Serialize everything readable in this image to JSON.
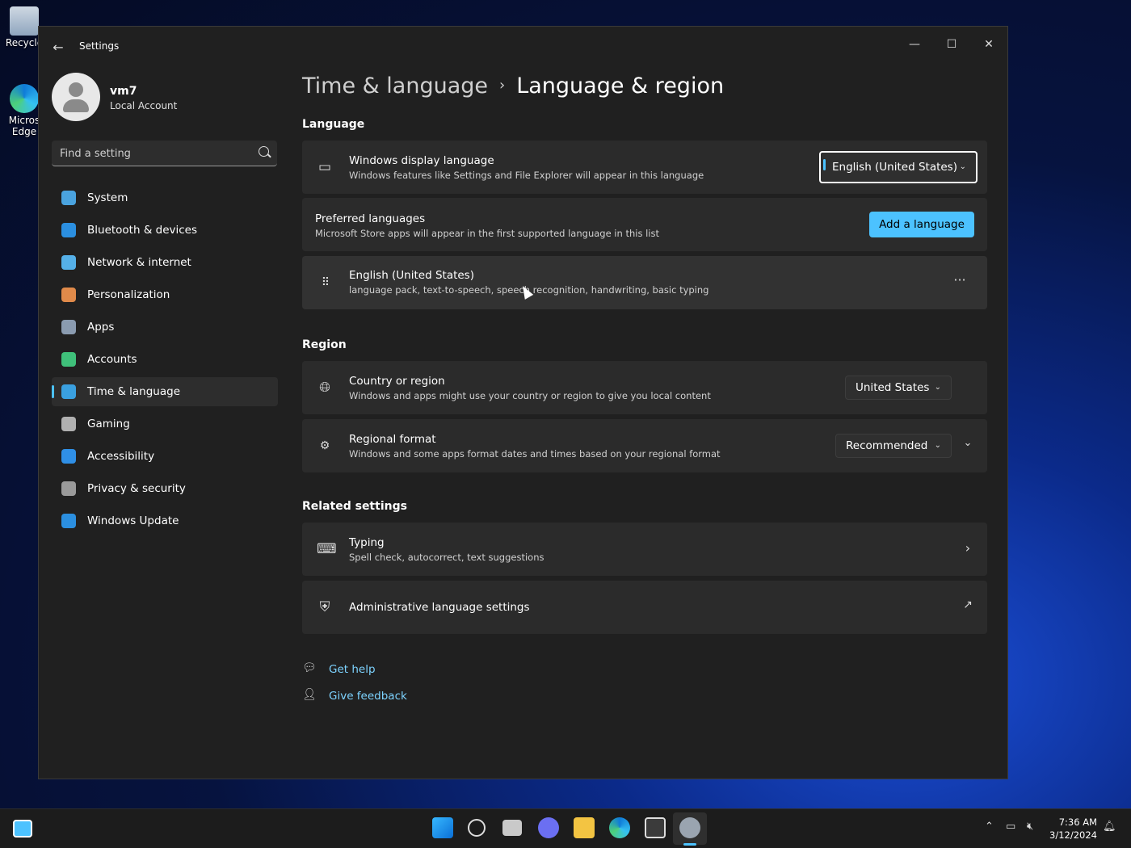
{
  "desktop": {
    "recycle_label": "Recycle",
    "edge_label_line1": "Micros",
    "edge_label_line2": "Edge"
  },
  "window": {
    "back_glyph": "←",
    "app_title": "Settings",
    "min_glyph": "—",
    "max_glyph": "☐",
    "close_glyph": "✕"
  },
  "profile": {
    "name": "vm7",
    "subtitle": "Local Account"
  },
  "search": {
    "placeholder": "Find a setting"
  },
  "nav": {
    "items": [
      {
        "label": "System",
        "icon": "system-icon",
        "color": "#4aa3df"
      },
      {
        "label": "Bluetooth & devices",
        "icon": "bluetooth-icon",
        "color": "#2b8fe0"
      },
      {
        "label": "Network & internet",
        "icon": "network-icon",
        "color": "#55b0e8"
      },
      {
        "label": "Personalization",
        "icon": "brush-icon",
        "color": "#e08a4a"
      },
      {
        "label": "Apps",
        "icon": "apps-icon",
        "color": "#8a9bb0"
      },
      {
        "label": "Accounts",
        "icon": "accounts-icon",
        "color": "#3fc07a"
      },
      {
        "label": "Time & language",
        "icon": "globe-clock-icon",
        "color": "#3aa0e0"
      },
      {
        "label": "Gaming",
        "icon": "gamepad-icon",
        "color": "#b0b0b0"
      },
      {
        "label": "Accessibility",
        "icon": "accessibility-icon",
        "color": "#2f8fe6"
      },
      {
        "label": "Privacy & security",
        "icon": "shield-icon",
        "color": "#9a9a9a"
      },
      {
        "label": "Windows Update",
        "icon": "update-icon",
        "color": "#2b8fe0"
      }
    ],
    "active_index": 6
  },
  "breadcrumb": {
    "parent": "Time & language",
    "separator": "›",
    "current": "Language & region"
  },
  "language": {
    "section_title": "Language",
    "display": {
      "title": "Windows display language",
      "desc": "Windows features like Settings and File Explorer will appear in this language",
      "value": "English (United States)"
    },
    "preferred": {
      "title": "Preferred languages",
      "desc": "Microsoft Store apps will appear in the first supported language in this list",
      "button": "Add a language"
    },
    "entry": {
      "title": "English (United States)",
      "desc": "language pack, text-to-speech, speech recognition, handwriting, basic typing",
      "more": "···"
    }
  },
  "region": {
    "section_title": "Region",
    "country": {
      "title": "Country or region",
      "desc": "Windows and apps might use your country or region to give you local content",
      "value": "United States"
    },
    "format": {
      "title": "Regional format",
      "desc": "Windows and some apps format dates and times based on your regional format",
      "value": "Recommended"
    }
  },
  "related": {
    "section_title": "Related settings",
    "typing": {
      "title": "Typing",
      "desc": "Spell check, autocorrect, text suggestions"
    },
    "admin": {
      "title": "Administrative language settings"
    }
  },
  "help": {
    "get_help": "Get help",
    "give_feedback": "Give feedback"
  },
  "taskbar": {
    "time": "7:36 AM",
    "date": "3/12/2024"
  }
}
